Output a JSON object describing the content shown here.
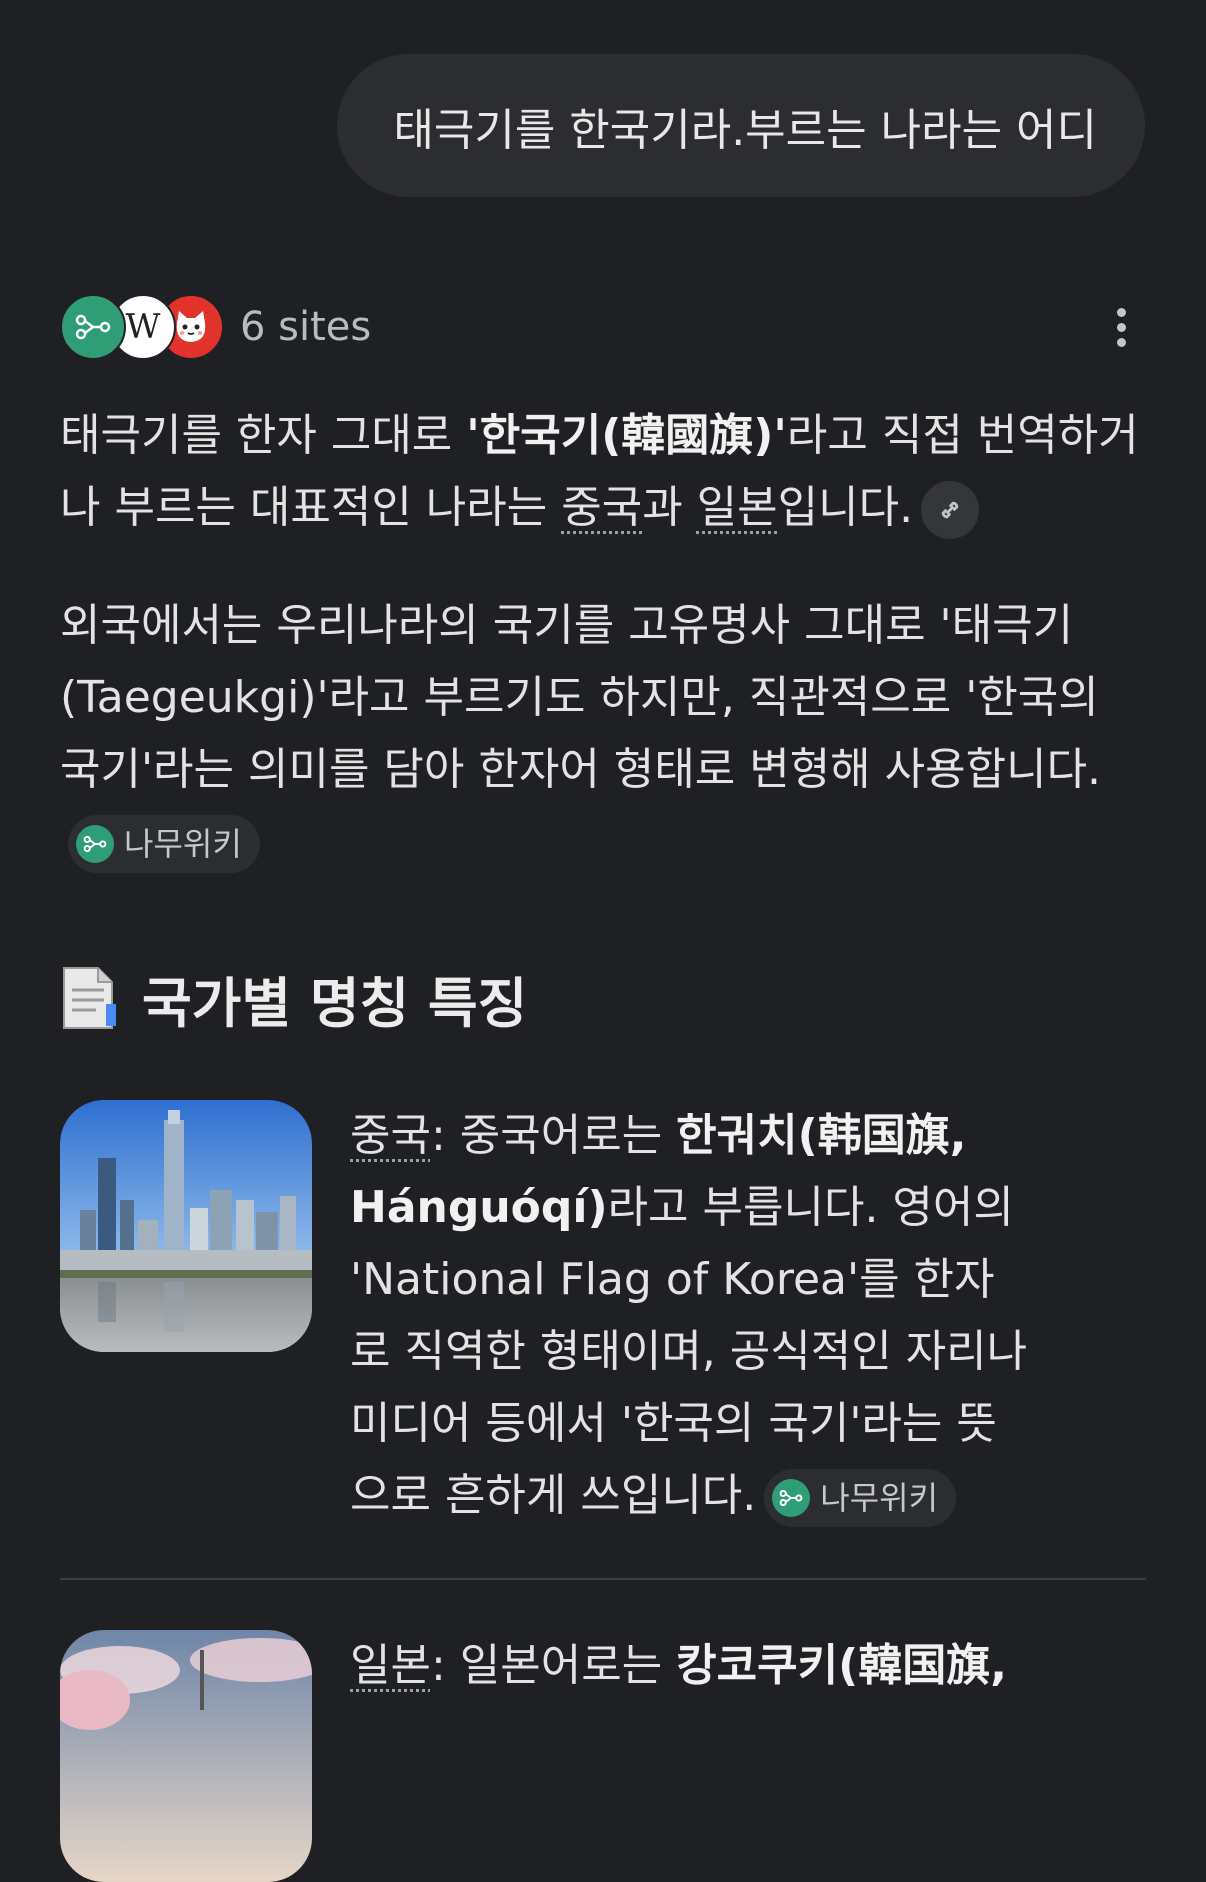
{
  "user_message": "태극기를 한국기라.부르는 나라는 어디",
  "sources": {
    "label": "6 sites",
    "icons": [
      "namuwiki-icon",
      "wikipedia-icon",
      "cat-face-icon"
    ],
    "wiki_letter": "W"
  },
  "answer": {
    "p1": {
      "t1": "태극기를 한자 그대로 ",
      "bold": "'한국기(韓國旗)'",
      "t2": "라고 직접 번역하거나 부르는 대표적인 나라는 ",
      "link1": "중국",
      "t3": "과 ",
      "link2": "일본",
      "t4": "입니다."
    },
    "p2": {
      "text": "외국에서는 우리나라의 국기를 고유명사 그대로 '태극기(Taegeukgi)'라고 부르기도 하지만, 직관적으로 '한국의 국기'라는 의미를 담아 한자어 형태로 변형해 사용합니다.",
      "source_chip": "나무위키"
    },
    "section_heading": "국가별 명칭 특징",
    "cards": [
      {
        "title": "중국",
        "t1": ": 중국어로는 ",
        "bold": "한궈치(韩国旗, Hánguóqí)",
        "t2": "라고 부릅니다. 영어의 'National Flag of Korea'를 한자로 직역한 형태이며, 공식적인 자리나 미디어 등에서 '한국의 국기'라는 뜻으로 흔하게 쓰입니다.",
        "source_chip": "나무위키"
      },
      {
        "title": "일본",
        "t1": ": 일본어로는 ",
        "bold": "캉코쿠키(韓国旗,"
      }
    ]
  },
  "colors": {
    "background": "#1f2023",
    "bubble": "#2c2d30",
    "namu_green": "#2f9e76",
    "text": "#e3e3e3"
  }
}
